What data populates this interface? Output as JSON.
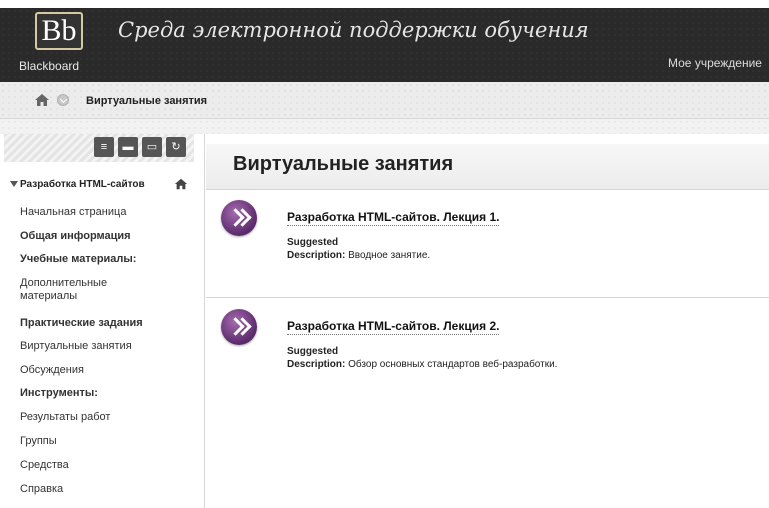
{
  "header": {
    "logo_text": "Blackboard",
    "logo_mark": "Bb",
    "site_title": "Среда электронной поддержки обучения",
    "institution": "Мое учреждение"
  },
  "breadcrumb": {
    "current": "Виртуальные занятия"
  },
  "sidebar": {
    "course_title": "Разработка HTML-сайтов",
    "toolbar_icons": [
      "list-icon",
      "folder-icon",
      "window-icon",
      "refresh-icon"
    ],
    "items": [
      {
        "label": "Начальная страница",
        "bold": false
      },
      {
        "label": "Общая информация",
        "bold": true
      },
      {
        "label": "Учебные материалы:",
        "bold": true
      },
      {
        "label": "Дополнительные материалы",
        "bold": false
      },
      {
        "label": "Практические задания",
        "bold": true
      },
      {
        "label": "Виртуальные занятия",
        "bold": false
      },
      {
        "label": "Обсуждения",
        "bold": false
      },
      {
        "label": "Инструменты:",
        "bold": true
      },
      {
        "label": "Результаты работ",
        "bold": false
      },
      {
        "label": "Группы",
        "bold": false
      },
      {
        "label": "Средства",
        "bold": false
      },
      {
        "label": "Справка",
        "bold": false
      }
    ]
  },
  "content": {
    "title": "Виртуальные занятия",
    "items": [
      {
        "title": "Разработка HTML-сайтов. Лекция 1.",
        "status": "Suggested",
        "description_label": "Description:",
        "description": "Вводное занятие."
      },
      {
        "title": "Разработка HTML-сайтов. Лекция 2.",
        "status": "Suggested",
        "description_label": "Description:",
        "description": "Обзор основных стандартов веб-разработки."
      }
    ]
  }
}
